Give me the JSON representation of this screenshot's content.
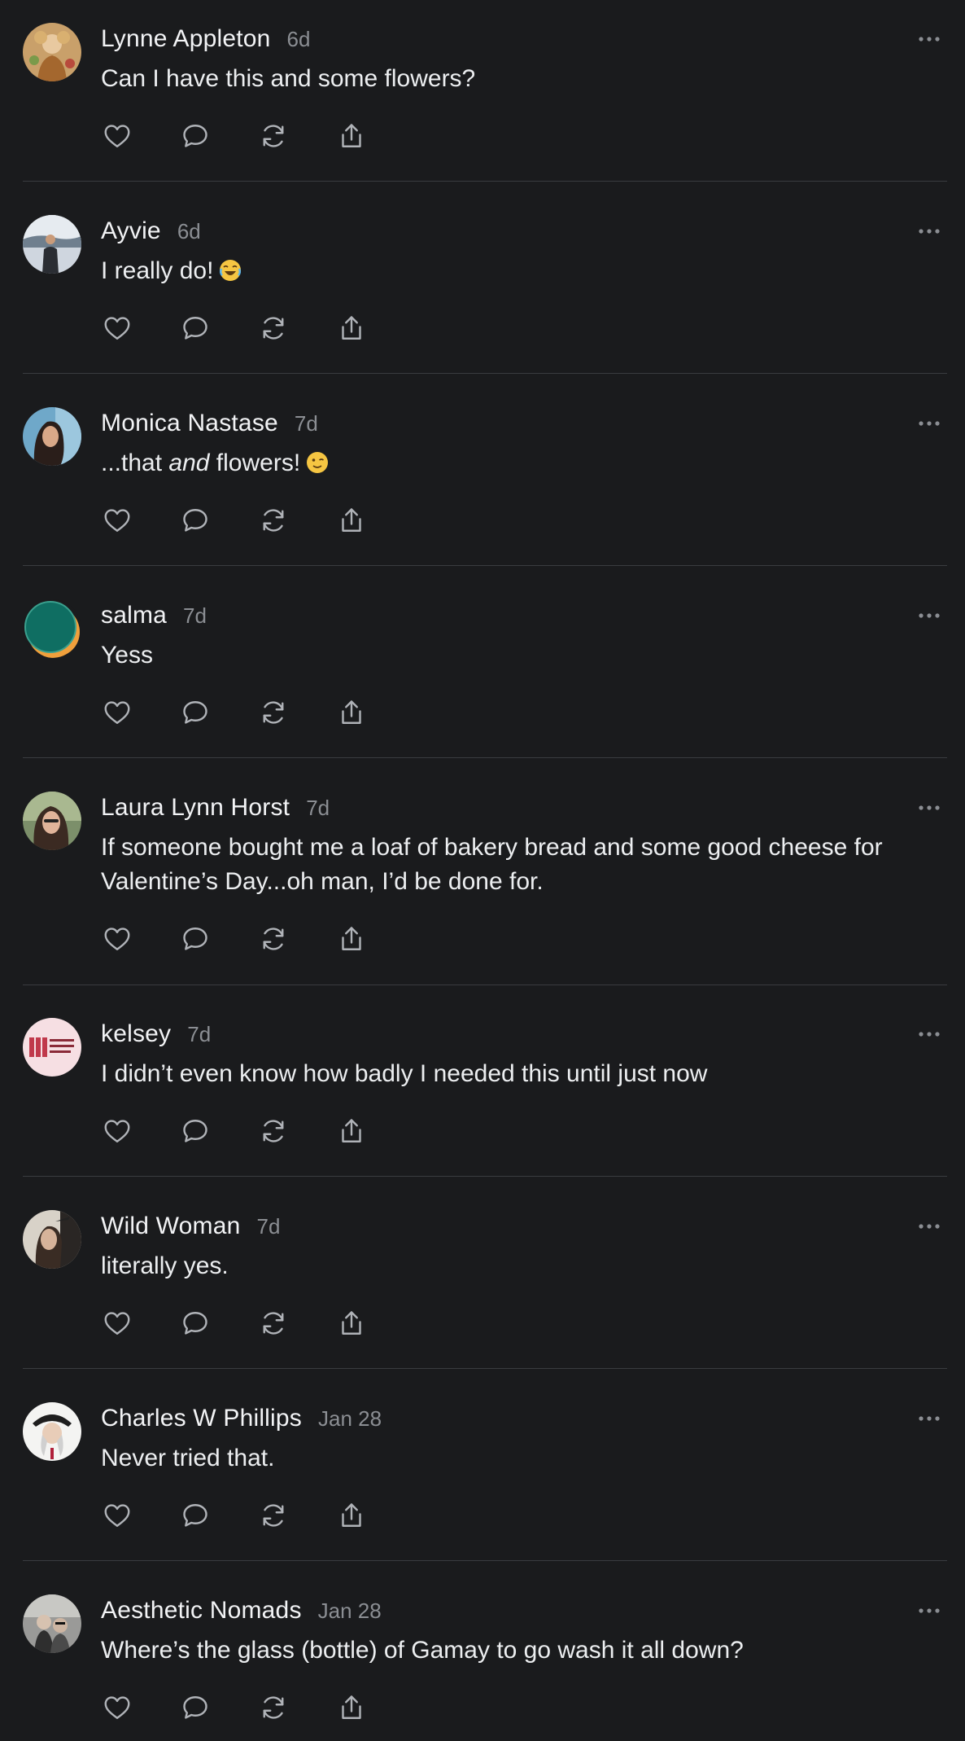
{
  "posts": [
    {
      "author": "Lynne Appleton",
      "time": "6d",
      "text": "Can I have this and some flowers?",
      "avatar": "painting-avatar"
    },
    {
      "author": "Ayvie",
      "time": "6d",
      "text": "I really do!",
      "emoji": "joy-emoji",
      "avatar": "outdoor-photo-avatar"
    },
    {
      "author": "Monica Nastase",
      "time": "7d",
      "text_before": "...that ",
      "text_em": "and",
      "text_after": " flowers!",
      "emoji": "wink-emoji",
      "avatar": "portrait-avatar"
    },
    {
      "author": "salma",
      "time": "7d",
      "text": "Yess",
      "avatar": "color-circle-avatar"
    },
    {
      "author": "Laura Lynn Horst",
      "time": "7d",
      "text": "If someone bought me a loaf of bakery bread and some good cheese for Valentine’s Day...oh man, I’d be done for.",
      "avatar": "portrait-avatar"
    },
    {
      "author": "kelsey",
      "time": "7d",
      "text": "I didn’t even know how badly I needed this until just now",
      "avatar": "logo-avatar"
    },
    {
      "author": "Wild Woman",
      "time": "7d",
      "text": "literally yes.",
      "avatar": "portrait-avatar"
    },
    {
      "author": "Charles W Phillips",
      "time": "Jan 28",
      "text": "Never tried that.",
      "avatar": "illustration-avatar"
    },
    {
      "author": "Aesthetic Nomads",
      "time": "Jan 28",
      "text": "Where’s the glass (bottle) of Gamay to go wash it all down?",
      "avatar": "couple-photo-avatar"
    }
  ],
  "icons": {
    "like": "heart-icon",
    "reply": "comment-icon",
    "repost": "repost-icon",
    "share": "share-icon",
    "more": "more-icon"
  },
  "colors": {
    "background": "#1a1b1d",
    "text": "#eceef0",
    "muted": "#8b8e93",
    "divider": "#3a3c40"
  }
}
